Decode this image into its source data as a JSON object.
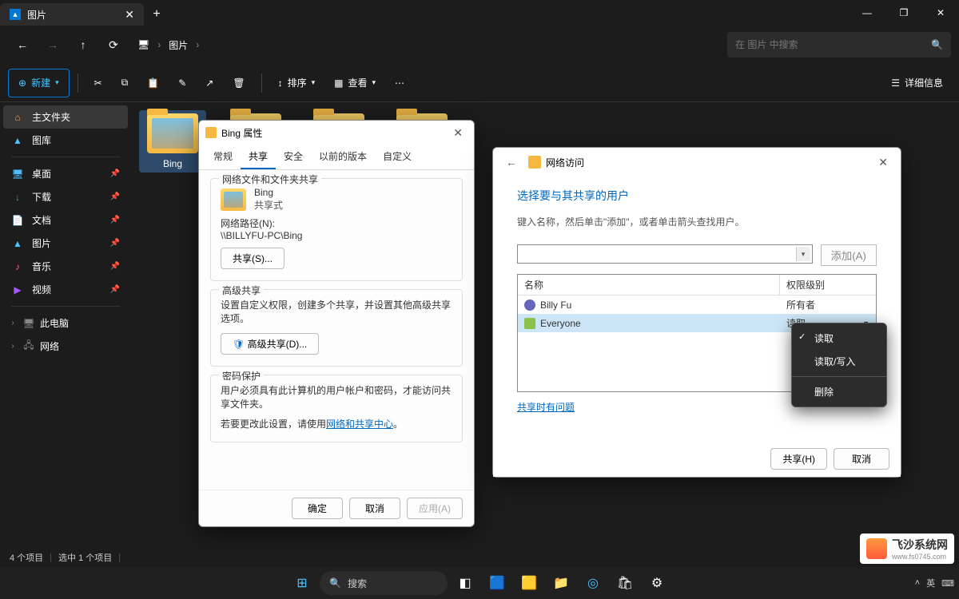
{
  "window": {
    "tab_title": "图片",
    "minimize": "—",
    "maximize": "❐",
    "close": "✕"
  },
  "nav": {
    "back": "←",
    "forward": "→",
    "up": "↑",
    "refresh": "⟳",
    "root_icon": "🖥",
    "crumb1": "图片",
    "search_placeholder": "在 图片 中搜索"
  },
  "cmd": {
    "new": "新建",
    "sort": "排序",
    "view": "查看",
    "details": "详细信息"
  },
  "sidebar": {
    "home": "主文件夹",
    "gallery": "图库",
    "desktop": "桌面",
    "downloads": "下载",
    "documents": "文档",
    "pictures": "图片",
    "music": "音乐",
    "videos": "视频",
    "thispc": "此电脑",
    "network": "网络"
  },
  "folders": [
    {
      "name": "Bing"
    }
  ],
  "status": {
    "count": "4 个项目",
    "selected": "选中 1 个项目"
  },
  "prop": {
    "title": "Bing 属性",
    "tabs": {
      "general": "常规",
      "sharing": "共享",
      "security": "安全",
      "previous": "以前的版本",
      "custom": "自定义"
    },
    "group1_title": "网络文件和文件夹共享",
    "folder_name": "Bing",
    "shared_state": "共享式",
    "path_label": "网络路径(N):",
    "path_value": "\\\\BILLYFU-PC\\Bing",
    "share_btn": "共享(S)...",
    "group2_title": "高级共享",
    "adv_desc": "设置自定义权限，创建多个共享，并设置其他高级共享选项。",
    "adv_btn": "高级共享(D)...",
    "group3_title": "密码保护",
    "pw_line1": "用户必须具有此计算机的用户帐户和密码，才能访问共享文件夹。",
    "pw_line2_a": "若要更改此设置，请使用",
    "pw_link": "网络和共享中心",
    "ok": "确定",
    "cancel": "取消",
    "apply": "应用(A)"
  },
  "net": {
    "title": "网络访问",
    "heading": "选择要与其共享的用户",
    "hint": "键入名称，然后单击\"添加\"，或者单击箭头查找用户。",
    "add": "添加(A)",
    "col_name": "名称",
    "col_perm": "权限级别",
    "rows": [
      {
        "name": "Billy Fu",
        "perm": "所有者"
      },
      {
        "name": "Everyone",
        "perm": "读取"
      }
    ],
    "trouble": "共享时有问题",
    "share": "共享(H)",
    "cancel": "取消"
  },
  "ctx": {
    "read": "读取",
    "readwrite": "读取/写入",
    "remove": "删除"
  },
  "taskbar": {
    "search": "搜索",
    "lang": "英",
    "ime": "⌨"
  },
  "watermark": {
    "name": "飞沙系统网",
    "url": "www.fs0745.com"
  }
}
